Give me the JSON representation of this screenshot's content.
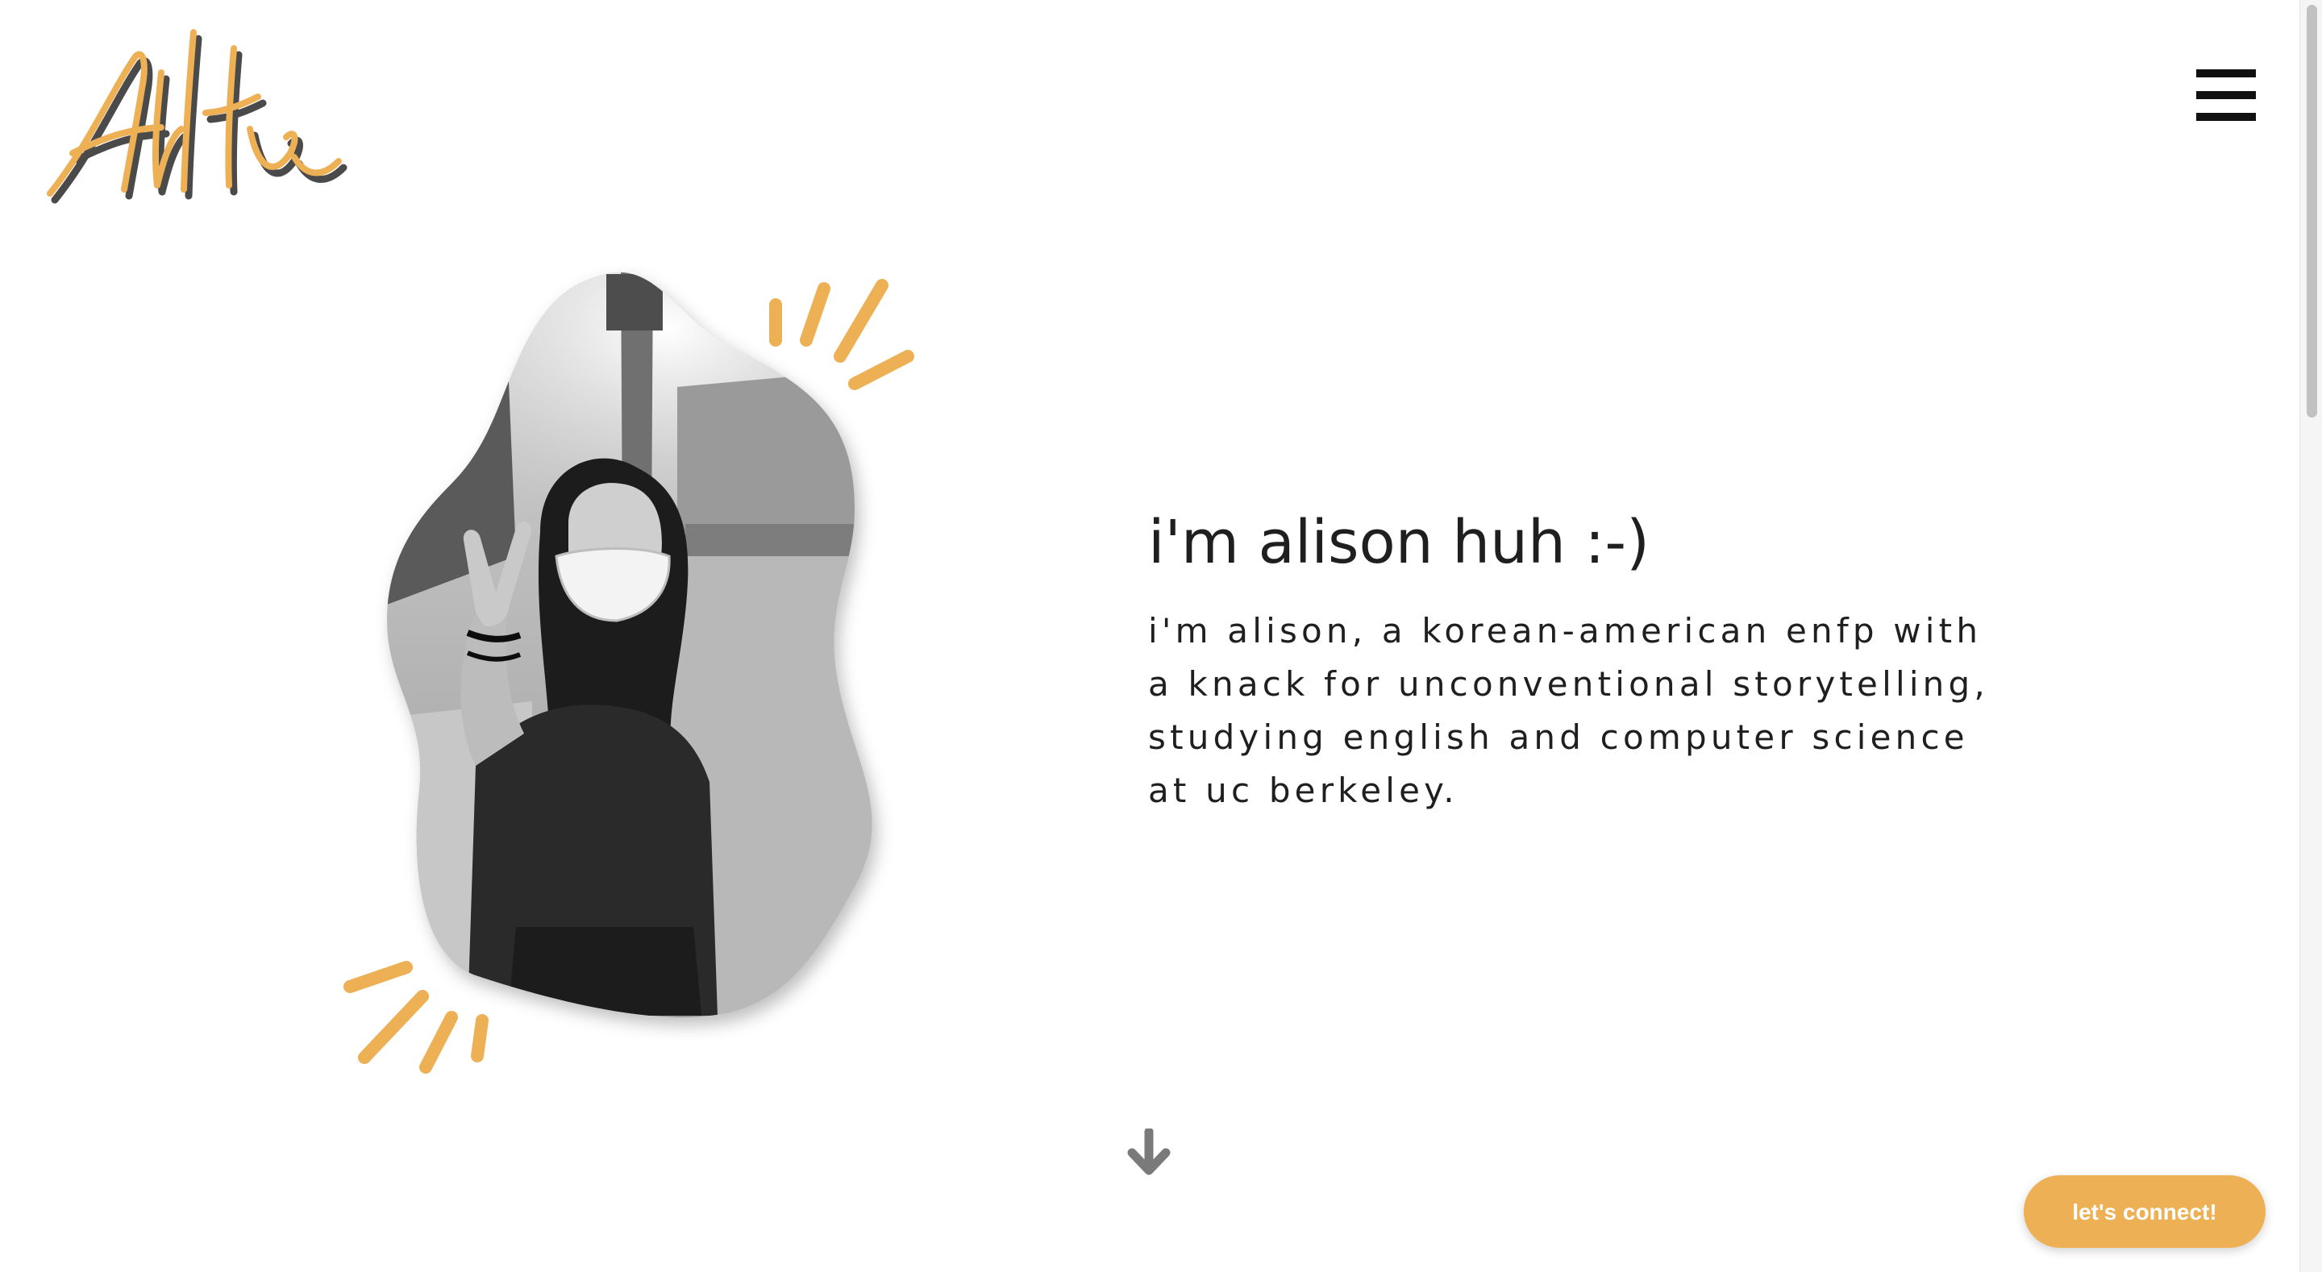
{
  "header": {
    "logo_text": "AliHuh",
    "menu_icon": "hamburger-menu-icon"
  },
  "hero": {
    "photo_alt": "black and white photo of alison wearing a mask and making a peace sign",
    "title": "i'm alison huh :-)",
    "body_lines": [
      "i'm alison, a korean-american enfp with",
      "a knack for unconventional storytelling,",
      "studying english and computer science",
      "at uc berkeley."
    ]
  },
  "scroll_hint": {
    "icon": "arrow-down-icon"
  },
  "cta": {
    "label": "let's connect!"
  },
  "colors": {
    "accent": "#eeb055",
    "text": "#1f1f1f",
    "background": "#ffffff",
    "logo_shadow": "#4a4a4a"
  }
}
